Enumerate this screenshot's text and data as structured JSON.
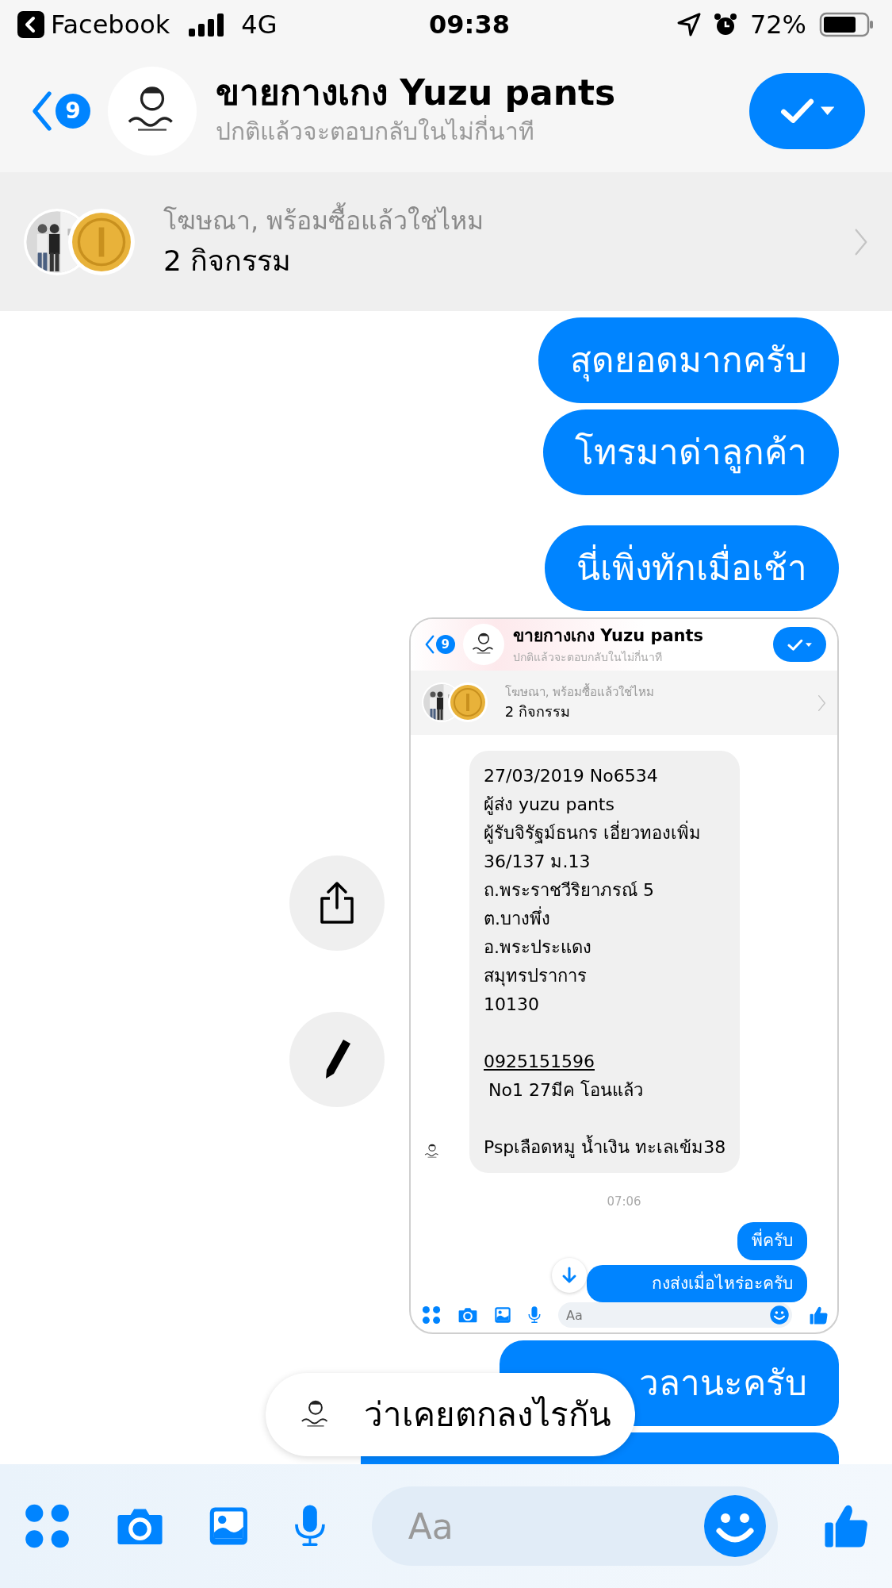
{
  "status_bar": {
    "back_app": "Facebook",
    "network": "4G",
    "time": "09:38",
    "battery": "72%"
  },
  "header": {
    "back_count": "9",
    "title": "ขายกางเกง Yuzu pants",
    "subtitle": "ปกติแล้วจะตอบกลับในไม่กี่นาที"
  },
  "ad_banner": {
    "text": "โฆษณา, พร้อมซื้อแล้วใช่ไหม",
    "count": "2 กิจกรรม"
  },
  "messages": [
    {
      "kind": "text",
      "text": "สุดยอดมากครับ"
    },
    {
      "kind": "text",
      "text": "โทรมาด่าลูกค้า"
    },
    {
      "kind": "text",
      "text": "นี่เพิ่งทักเมื่อเช้า"
    },
    {
      "kind": "screenshot",
      "screenshot": {
        "header": {
          "back_count": "9",
          "title": "ขายกางเกง Yuzu pants",
          "subtitle": "ปกติแล้วจะตอบกลับในไม่กี่นาที"
        },
        "ad_banner": {
          "text": "โฆษณา, พร้อมซื้อแล้วใช่ไหม",
          "count": "2 กิจกรรม"
        },
        "received": [
          {
            "lines": [
              {
                "kind": "text",
                "text": "27/03/2019 No6534"
              },
              {
                "kind": "text",
                "text": "ผู้ส่ง yuzu pants"
              },
              {
                "kind": "text",
                "text": "ผู้รับจิรัฐม์ธนกร เอี่ยวทองเพิ่ม"
              },
              {
                "kind": "text",
                "text": "36/137 ม.13"
              },
              {
                "kind": "text",
                "text": "ถ.พระราชวีริยาภรณ์ 5"
              },
              {
                "kind": "text",
                "text": "ต.บางพึ่ง"
              },
              {
                "kind": "text",
                "text": "อ.พระประแดง"
              },
              {
                "kind": "text",
                "text": "สมุทรปราการ"
              },
              {
                "kind": "text",
                "text": "10130"
              }
            ]
          },
          {
            "lines": [
              {
                "kind": "link",
                "text": "0925151596"
              },
              {
                "kind": "text",
                "text": "No1 27มีค โอนแล้ว"
              }
            ]
          },
          {
            "lines": [
              {
                "kind": "text",
                "text": "Pspเลือดหมู น้ำเงิน ทะเลเข้ม38"
              }
            ]
          }
        ],
        "time": "07:06",
        "sent": [
          "พี่ครับ",
          "กงส่งเมื่อไหร่อะครับ"
        ],
        "composer": {
          "placeholder": "Aa"
        }
      }
    },
    {
      "kind": "text",
      "text": "วลานะครับ"
    },
    {
      "kind": "covered"
    }
  ],
  "floating_reply": {
    "text": "ว่าเคยตกลงไรกัน"
  },
  "composer": {
    "placeholder": "Aa"
  }
}
